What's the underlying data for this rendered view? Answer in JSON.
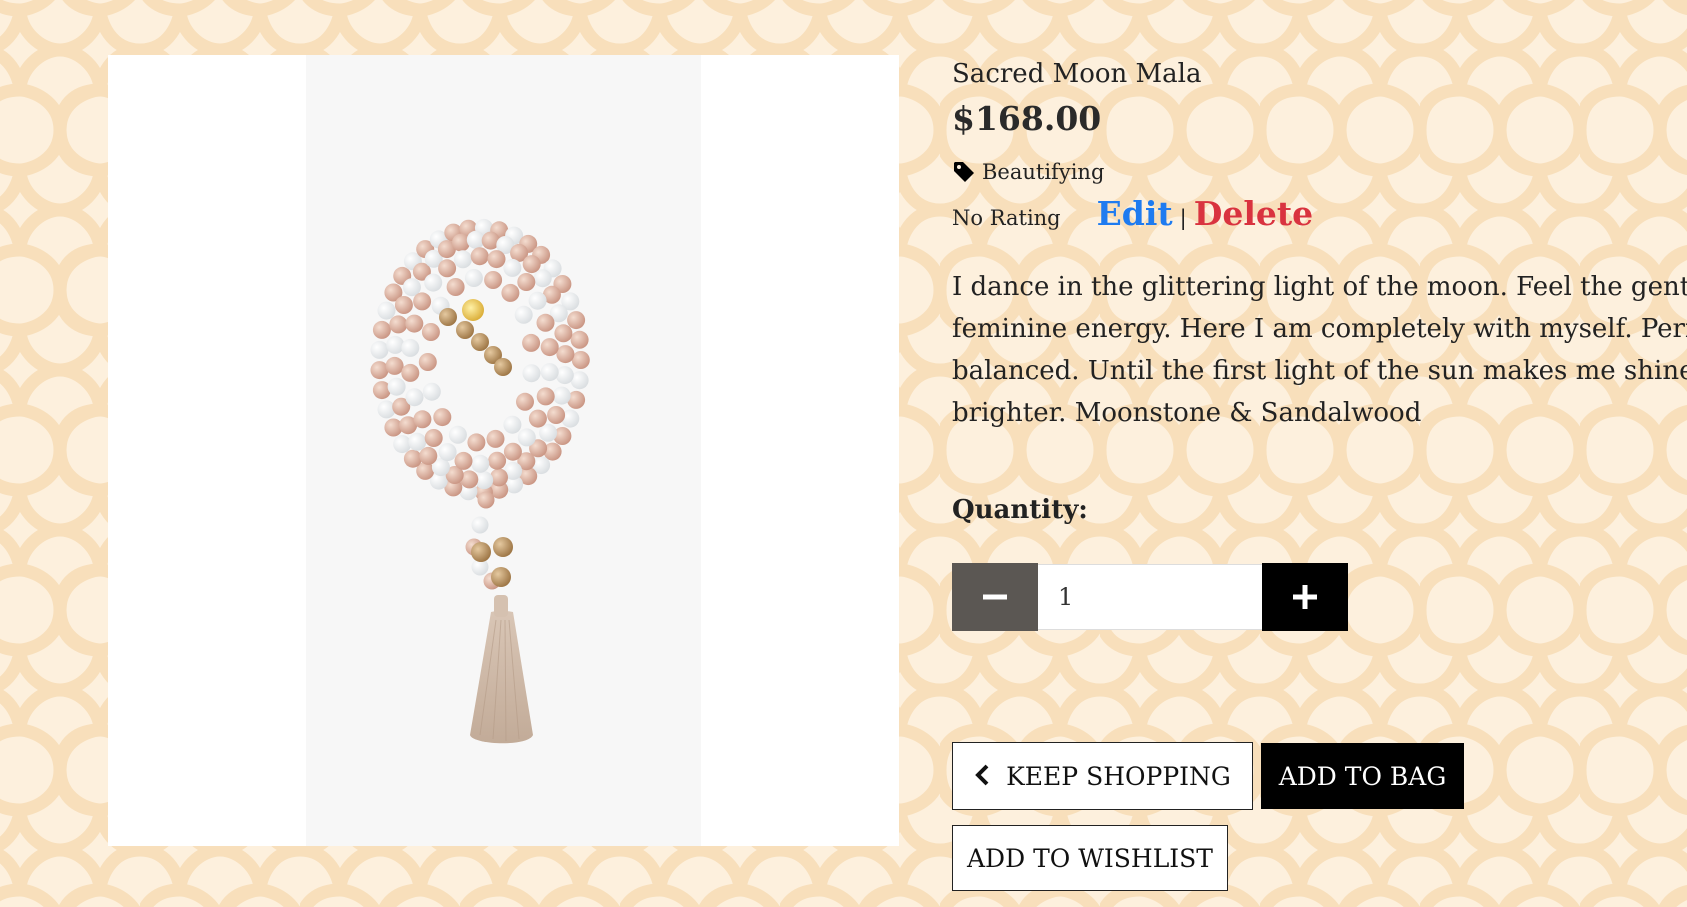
{
  "product": {
    "name": "Sacred Moon Mala",
    "price": "$168.00",
    "category": "Beautifying",
    "rating": "No Rating",
    "image_alt": "Sacred Moon Mala"
  },
  "admin": {
    "edit_label": "Edit",
    "separator": "|",
    "delete_label": "Delete"
  },
  "description": {
    "lines": [
      "I dance in the glittering light of the moon. Feel the gentle,",
      "feminine energy. Here I am completely with myself. Perfectly",
      "balanced. Until the first light of the sun makes me shine even",
      "brighter. Moonstone & Sandalwood"
    ]
  },
  "quantity": {
    "label": "Quantity:",
    "value": "1"
  },
  "buttons": {
    "keep_shopping": "KEEP SHOPPING",
    "add_to_bag": "ADD TO BAG",
    "add_to_wishlist": "ADD TO WISHLIST"
  },
  "colors": {
    "background": "#fdf0dd",
    "pattern": "#f8dfbb",
    "edit": "#1e7bf0",
    "delete": "#d9333f",
    "minus_button": "#5b5753",
    "plus_button": "#000000"
  },
  "icons": {
    "category": "tag-icon",
    "decrease": "minus-icon",
    "increase": "plus-icon",
    "back": "chevron-left-icon"
  }
}
